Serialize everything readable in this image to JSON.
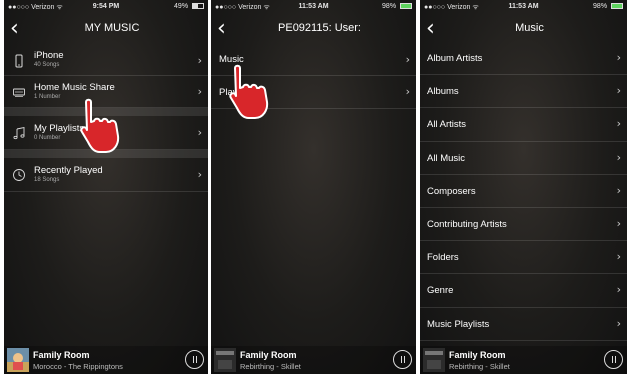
{
  "screens": [
    {
      "status": {
        "carrier": "●●○○○ Verizon ᯤ",
        "time": "9:54 PM",
        "battery": "49%"
      },
      "nav": {
        "back": "‹",
        "title": "MY MUSIC"
      },
      "rows": [
        {
          "label": "iPhone",
          "sub": "40 Songs",
          "chevron": "›"
        },
        {
          "label": "Home Music Share",
          "sub": "1 Number",
          "chevron": "›"
        },
        {
          "label": "My Playlists",
          "sub": "0 Number",
          "chevron": "›"
        },
        {
          "label": "Recently Played",
          "sub": "18 Songs",
          "chevron": "›"
        }
      ],
      "player": {
        "room": "Family Room",
        "track": "Morocco - The Rippingtons"
      }
    },
    {
      "status": {
        "carrier": "●●○○○ Verizon ᯤ",
        "time": "11:53 AM",
        "battery": "98%"
      },
      "nav": {
        "back": "‹",
        "title": "PE092115: User:"
      },
      "rows": [
        {
          "label": "Music",
          "chevron": "›"
        },
        {
          "label": "Playlists",
          "chevron": "›"
        }
      ],
      "player": {
        "room": "Family Room",
        "track": "Rebirthing - Skillet"
      }
    },
    {
      "status": {
        "carrier": "●●○○○ Verizon ᯤ",
        "time": "11:53 AM",
        "battery": "98%"
      },
      "nav": {
        "back": "‹",
        "title": "Music"
      },
      "rows": [
        {
          "label": "Album Artists",
          "chevron": "›"
        },
        {
          "label": "Albums",
          "chevron": "›"
        },
        {
          "label": "All Artists",
          "chevron": "›"
        },
        {
          "label": "All Music",
          "chevron": "›"
        },
        {
          "label": "Composers",
          "chevron": "›"
        },
        {
          "label": "Contributing Artists",
          "chevron": "›"
        },
        {
          "label": "Folders",
          "chevron": "›"
        },
        {
          "label": "Genre",
          "chevron": "›"
        },
        {
          "label": "Music Playlists",
          "chevron": "›"
        }
      ],
      "player": {
        "room": "Family Room",
        "track": "Rebirthing - Skillet"
      }
    }
  ],
  "icons": {
    "s1_row1": "iphone-icon",
    "s1_row2": "home-share-icon",
    "s1_row3": "music-note-icon",
    "s1_row4": "clock-icon",
    "hand": "pointing-hand-icon",
    "pause": "pause-icon"
  },
  "colors": {
    "hand_red": "#d8262a",
    "hand_outline": "#ffffff",
    "battery_green": "#5fd35f"
  }
}
